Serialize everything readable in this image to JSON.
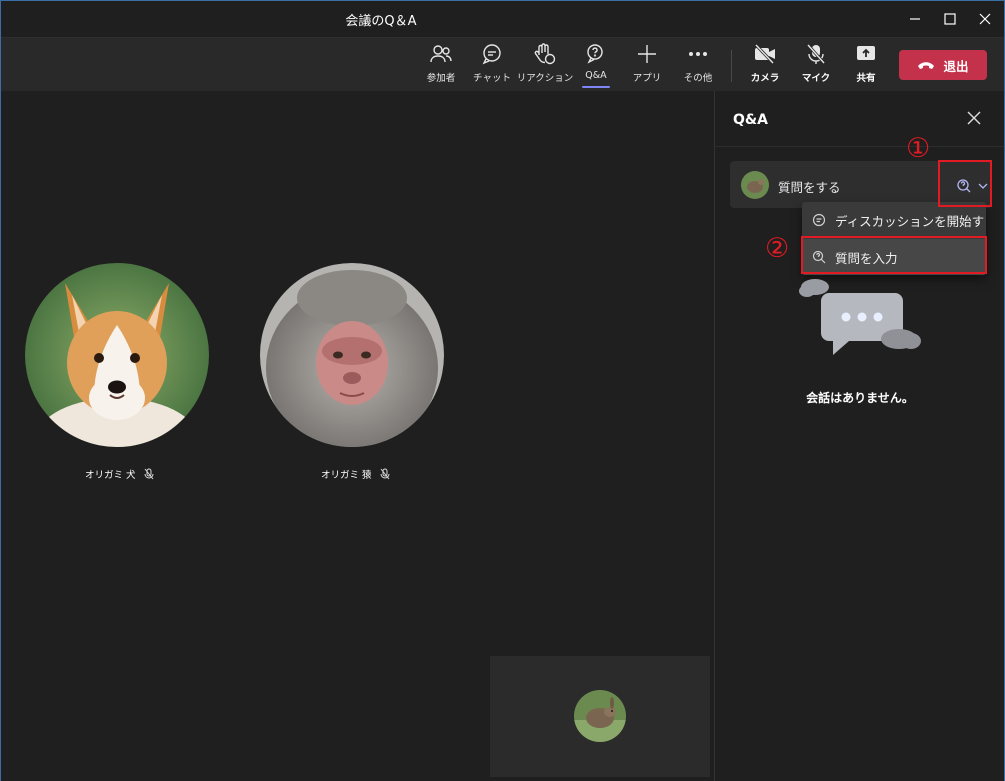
{
  "window": {
    "title": "会議のQ＆A"
  },
  "toolbar": {
    "participants": "参加者",
    "chat": "チャット",
    "reactions": "リアクション",
    "qa": "Q&A",
    "apps": "アプリ",
    "more": "その他",
    "camera": "カメラ",
    "mic": "マイク",
    "share": "共有",
    "leave": "退出"
  },
  "participants": [
    {
      "name": "オリガミ 犬"
    },
    {
      "name": "オリガミ 猿"
    }
  ],
  "panel": {
    "title": "Q&A",
    "ask_placeholder": "質問をする",
    "menu": {
      "start_discussion": "ディスカッションを開始す",
      "ask_question": "質問を入力"
    },
    "empty_text": "会話はありません。"
  },
  "annotations": {
    "step1": "①",
    "step2": "②"
  },
  "colors": {
    "accent": "#7f85f5",
    "leave": "#c4314b",
    "highlight": "#e01b24"
  }
}
